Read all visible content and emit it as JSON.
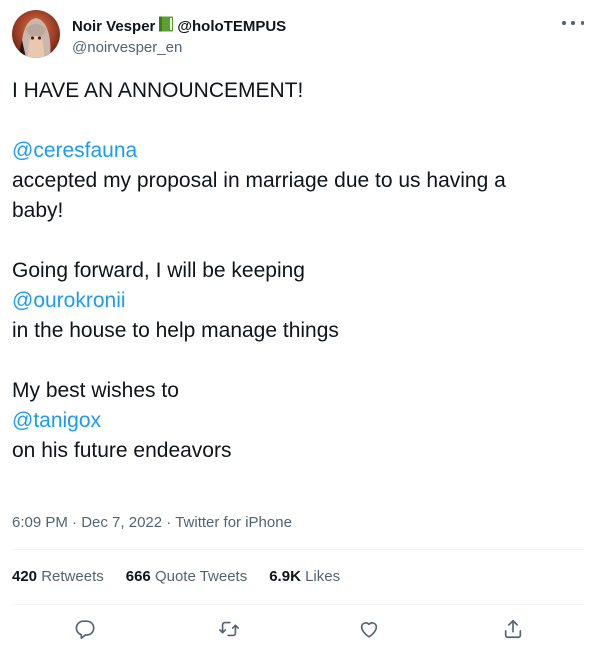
{
  "author": {
    "display_name": "Noir Vesper",
    "name_suffix": "@holoTEMPUS",
    "handle": "@noirvesper_en",
    "badge_icon": "green-book-icon"
  },
  "tweet": {
    "lines": [
      {
        "text": "I HAVE AN ANNOUNCEMENT!",
        "type": "text"
      },
      {
        "text": "",
        "type": "gap"
      },
      {
        "text": "@ceresfauna",
        "type": "mention"
      },
      {
        "text": "accepted my proposal in marriage due to us having a",
        "type": "text"
      },
      {
        "text": "baby!",
        "type": "text"
      },
      {
        "text": "",
        "type": "gap"
      },
      {
        "text": "Going forward, I will be keeping",
        "type": "text"
      },
      {
        "text": "@ourokronii",
        "type": "mention"
      },
      {
        "text": "in the house to help manage things",
        "type": "text"
      },
      {
        "text": "",
        "type": "gap"
      },
      {
        "text": "My best wishes to",
        "type": "text"
      },
      {
        "text": "@tanigox",
        "type": "mention"
      },
      {
        "text": "on his future endeavors",
        "type": "text"
      }
    ]
  },
  "meta": {
    "time": "6:09 PM",
    "separator": "·",
    "date": "Dec 7, 2022",
    "source": "Twitter for iPhone"
  },
  "stats": {
    "retweets_count": "420",
    "retweets_label": "Retweets",
    "quotes_count": "666",
    "quotes_label": "Quote Tweets",
    "likes_count": "6.9K",
    "likes_label": "Likes"
  },
  "colors": {
    "mention": "#1d9bf0",
    "secondary_text": "#536471",
    "primary_text": "#0f1419",
    "divider": "#eff3f4"
  },
  "icons": {
    "reply": "reply-icon",
    "retweet": "retweet-icon",
    "like": "heart-icon",
    "share": "share-icon",
    "more": "more-options-icon"
  }
}
